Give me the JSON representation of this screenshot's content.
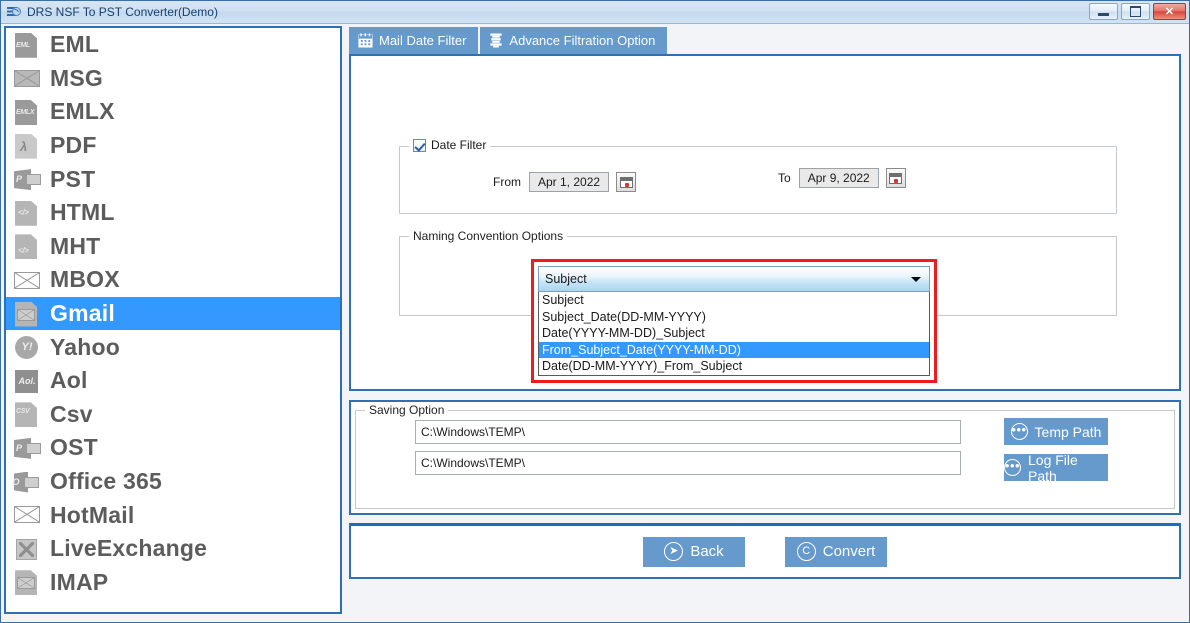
{
  "window": {
    "title": "DRS NSF To PST Converter(Demo)",
    "icon": "app-icon",
    "buttons": {
      "minimize": "minimize",
      "maximize": "maximize",
      "close": "close"
    }
  },
  "colors": {
    "accent_blue": "#6699cc",
    "selection_blue": "#3399ff",
    "panel_border": "#2f6fb5",
    "highlight_red": "#ee1c1c",
    "icon_grey": "#9a9a9a"
  },
  "sidebar": {
    "items": [
      {
        "label": "EML",
        "icon": "eml-file-icon",
        "selected": false
      },
      {
        "label": "MSG",
        "icon": "msg-envelope-icon",
        "selected": false
      },
      {
        "label": "EMLX",
        "icon": "emlx-file-icon",
        "selected": false
      },
      {
        "label": "PDF",
        "icon": "pdf-file-icon",
        "selected": false
      },
      {
        "label": "PST",
        "icon": "pst-outlook-icon",
        "selected": false
      },
      {
        "label": "HTML",
        "icon": "html-file-icon",
        "selected": false
      },
      {
        "label": "MHT",
        "icon": "mht-file-icon",
        "selected": false
      },
      {
        "label": "MBOX",
        "icon": "mbox-envelope-icon",
        "selected": false
      },
      {
        "label": "Gmail",
        "icon": "gmail-icon",
        "selected": true
      },
      {
        "label": "Yahoo",
        "icon": "yahoo-icon",
        "selected": false
      },
      {
        "label": "Aol",
        "icon": "aol-icon",
        "selected": false
      },
      {
        "label": "Csv",
        "icon": "csv-file-icon",
        "selected": false
      },
      {
        "label": "OST",
        "icon": "ost-outlook-icon",
        "selected": false
      },
      {
        "label": "Office 365",
        "icon": "office365-icon",
        "selected": false
      },
      {
        "label": "HotMail",
        "icon": "hotmail-icon",
        "selected": false
      },
      {
        "label": "LiveExchange",
        "icon": "live-exchange-icon",
        "selected": false
      },
      {
        "label": "IMAP",
        "icon": "imap-icon",
        "selected": false
      }
    ]
  },
  "tabs": [
    {
      "label": "Mail Date Filter",
      "icon": "calendar-icon",
      "active": true
    },
    {
      "label": "Advance Filtration Option",
      "icon": "filter-icon",
      "active": false
    }
  ],
  "date_filter": {
    "checkbox_label": "Date Filter",
    "checked": true,
    "from_label": "From",
    "from_value": "Apr 1, 2022",
    "to_label": "To",
    "to_value": "Apr 9, 2022",
    "calendar_icon": "calendar-picker-icon"
  },
  "naming_convention": {
    "group_label": "Naming Convention Options",
    "selected_value": "Subject",
    "dropdown_open": true,
    "options": [
      {
        "label": "Subject",
        "highlighted": false
      },
      {
        "label": "Subject_Date(DD-MM-YYYY)",
        "highlighted": false
      },
      {
        "label": "Date(YYYY-MM-DD)_Subject",
        "highlighted": false
      },
      {
        "label": "From_Subject_Date(YYYY-MM-DD)",
        "highlighted": true
      },
      {
        "label": "Date(DD-MM-YYYY)_From_Subject",
        "highlighted": false
      }
    ]
  },
  "saving_option": {
    "group_label": "Saving Option",
    "temp_path_value": "C:\\Windows\\TEMP\\",
    "log_path_value": "C:\\Windows\\TEMP\\",
    "temp_path_button": "Temp Path",
    "log_path_button": "Log File Path",
    "button_icon": "ellipsis-circle-icon"
  },
  "actions": {
    "back_label": "Back",
    "back_icon": "arrow-right-circle-icon",
    "convert_label": "Convert",
    "convert_icon": "copyright-circle-icon"
  }
}
